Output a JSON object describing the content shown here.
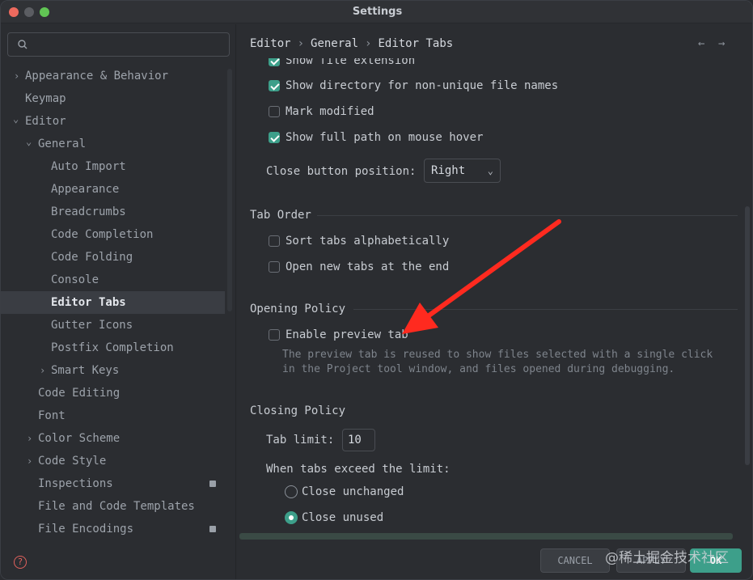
{
  "window": {
    "title": "Settings"
  },
  "search": {
    "placeholder": "",
    "value": ""
  },
  "sidebar": {
    "items": [
      {
        "label": "Appearance & Behavior",
        "chevron": "›"
      },
      {
        "label": "Keymap"
      },
      {
        "label": "Editor",
        "chevron": "⌄"
      },
      {
        "label": "General",
        "chevron": "⌄"
      },
      {
        "label": "Auto Import"
      },
      {
        "label": "Appearance"
      },
      {
        "label": "Breadcrumbs"
      },
      {
        "label": "Code Completion"
      },
      {
        "label": "Code Folding"
      },
      {
        "label": "Console"
      },
      {
        "label": "Editor Tabs",
        "selected": true
      },
      {
        "label": "Gutter Icons"
      },
      {
        "label": "Postfix Completion"
      },
      {
        "label": "Smart Keys",
        "chevron": "›"
      },
      {
        "label": "Code Editing"
      },
      {
        "label": "Font"
      },
      {
        "label": "Color Scheme",
        "chevron": "›"
      },
      {
        "label": "Code Style",
        "chevron": "›"
      },
      {
        "label": "Inspections",
        "badge": true
      },
      {
        "label": "File and Code Templates"
      },
      {
        "label": "File Encodings",
        "badge": true
      }
    ]
  },
  "breadcrumb": {
    "part1": "Editor",
    "part2": "General",
    "part3": "Editor Tabs",
    "sep": "›"
  },
  "nav": {
    "back": "←",
    "forward": "→"
  },
  "appearance": {
    "show_file_extension": {
      "label": "Show file extension",
      "checked": true
    },
    "show_directory": {
      "label": "Show directory for non-unique file names",
      "checked": true
    },
    "mark_modified": {
      "label": "Mark modified",
      "checked": false
    },
    "show_full_path": {
      "label": "Show full path on mouse hover",
      "checked": true
    },
    "close_button_label": "Close button position:",
    "close_button_value": "Right",
    "select_arrow": "⌄"
  },
  "tab_order": {
    "title": "Tab Order",
    "sort_alpha": {
      "label": "Sort tabs alphabetically",
      "checked": false
    },
    "open_at_end": {
      "label": "Open new tabs at the end",
      "checked": false
    }
  },
  "opening_policy": {
    "title": "Opening Policy",
    "enable_preview": {
      "label": "Enable preview tab",
      "checked": false
    },
    "hint_line1": "The preview tab is reused to show files selected with a single click",
    "hint_line2": "in the Project tool window, and files opened during debugging."
  },
  "closing_policy": {
    "title": "Closing Policy",
    "tab_limit_label": "Tab limit:",
    "tab_limit_value": "10",
    "exceed_label": "When tabs exceed the limit:",
    "close_unchanged": {
      "label": "Close unchanged",
      "selected": false
    },
    "close_unused": {
      "label": "Close unused",
      "selected": true
    }
  },
  "buttons": {
    "cancel": "CANCEL",
    "apply": "APPLY",
    "ok": "OK"
  },
  "help": {
    "glyph": "?"
  },
  "watermark": "@稀土掘金技术社区",
  "colors": {
    "accent": "#3d9f8a",
    "annotation_arrow": "#ff2a1f",
    "close_dot": "#ed6a5e",
    "max_dot": "#61c554"
  }
}
